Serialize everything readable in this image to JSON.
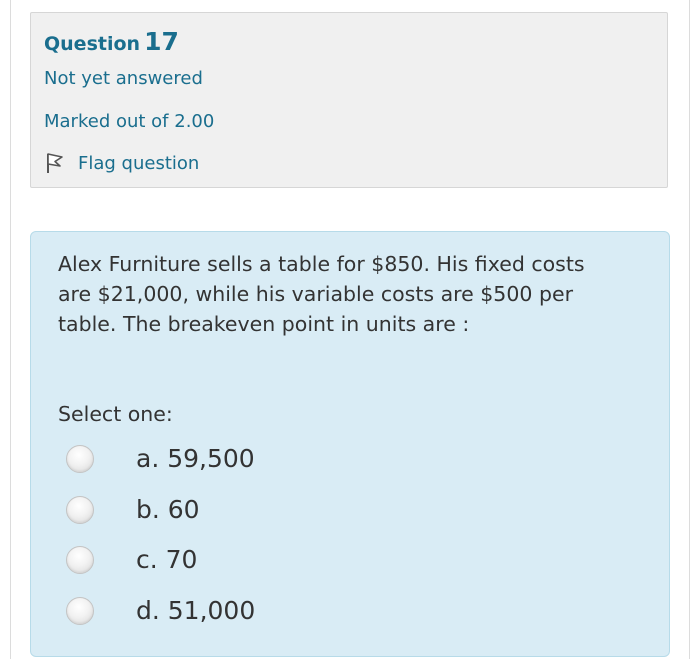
{
  "question": {
    "label": "Question",
    "number": "17",
    "state": "Not yet answered",
    "grade": "Marked out of 2.00",
    "flag_label": "Flag question",
    "flag_icon": "flag-icon"
  },
  "content": {
    "text": "Alex Furniture sells a table for $850. His fixed costs are $21,000, while his variable costs are $500 per table. The breakeven point in units are :",
    "prompt": "Select one:",
    "options": [
      {
        "label": "a. 59,500",
        "selected": false
      },
      {
        "label": "b. 60",
        "selected": false
      },
      {
        "label": "c. 70",
        "selected": false
      },
      {
        "label": "d. 51,000",
        "selected": false
      }
    ]
  },
  "colors": {
    "accent": "#1a6e8e",
    "info_bg": "#f0f0f0",
    "content_bg": "#d9ecf5",
    "content_border": "#b7dbe9",
    "text": "#333333"
  }
}
